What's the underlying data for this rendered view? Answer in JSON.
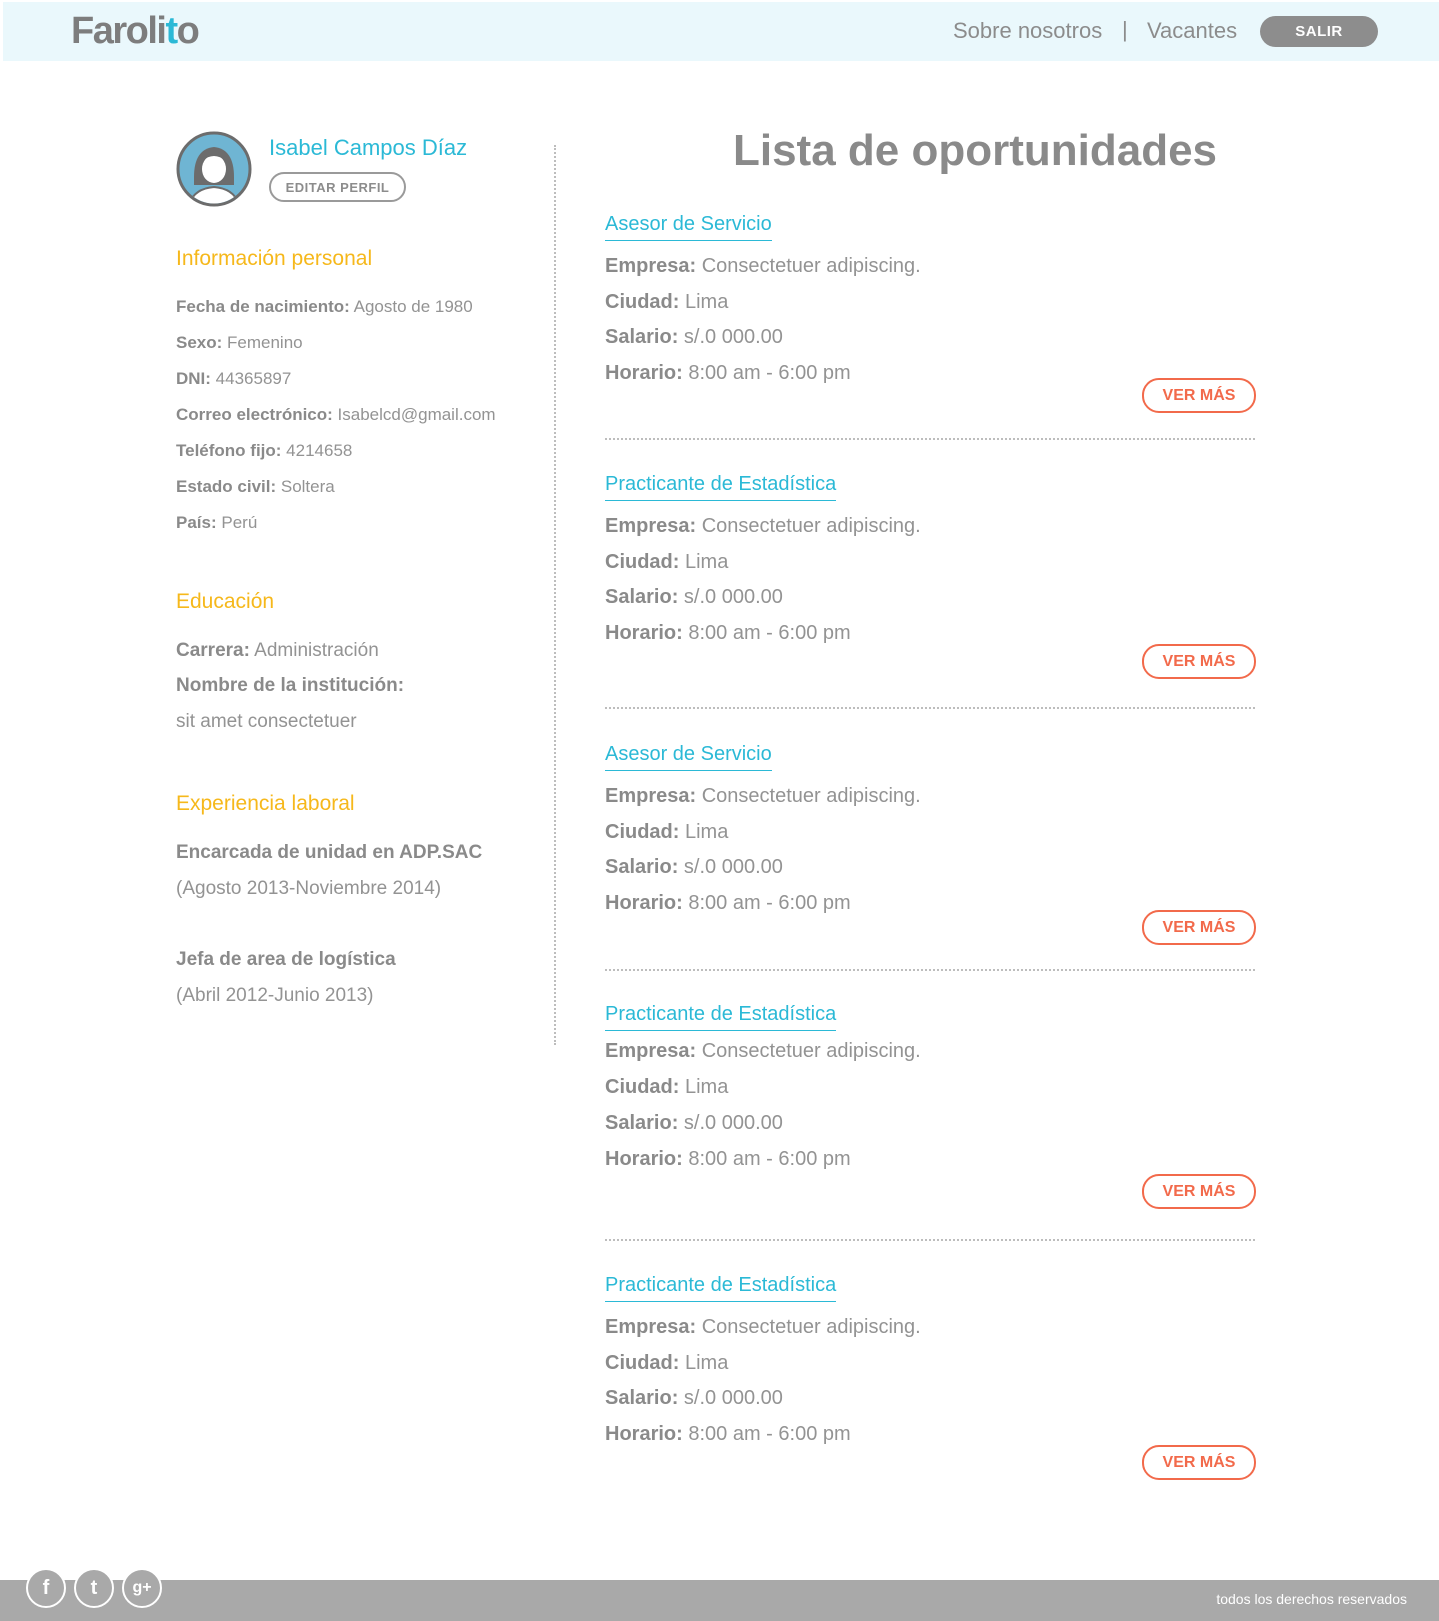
{
  "header": {
    "logo_main": "Faroli",
    "logo_accent": "t",
    "logo_tail": "o",
    "nav_about": "Sobre nosotros",
    "nav_separator": "|",
    "nav_jobs": "Vacantes",
    "logout_label": "SALIR"
  },
  "profile": {
    "name": "Isabel Campos Díaz",
    "edit_label": "EDITAR PERFIL",
    "personal_title": "Información personal",
    "personal": [
      {
        "label": "Fecha de nacimiento:",
        "value": " Agosto de 1980"
      },
      {
        "label": "Sexo:",
        "value": " Femenino"
      },
      {
        "label": "DNI:",
        "value": " 44365897"
      },
      {
        "label": "Correo electrónico:",
        "value": " Isabelcd@gmail.com"
      },
      {
        "label": "Teléfono fijo:",
        "value": " 4214658"
      },
      {
        "label": "Estado civil:",
        "value": " Soltera"
      },
      {
        "label": "País:",
        "value": " Perú"
      }
    ],
    "education_title": "Educación",
    "career_label": "Carrera:",
    "career_value": " Administración",
    "institution_label": "Nombre de la institución:",
    "institution_value": "sit amet consectetuer",
    "experience_title": "Experiencia laboral",
    "experience": [
      {
        "role": "Encarcada de unidad en ADP.SAC",
        "period": "(Agosto 2013-Noviembre 2014)"
      },
      {
        "role": "Jefa de area de logística",
        "period": "(Abril 2012-Junio 2013)"
      }
    ]
  },
  "opportunities": {
    "title": "Lista de oportunidades",
    "labels": {
      "company": "Empresa:",
      "city": "Ciudad:",
      "salary": "Salario:",
      "schedule": "Horario:"
    },
    "more_label": "VER MÁS",
    "jobs": [
      {
        "title": "Asesor de Servicio",
        "company": "  Consectetuer adipiscing.",
        "city": " Lima",
        "salary": " s/.0 000.00",
        "schedule": " 8:00 am - 6:00 pm"
      },
      {
        "title": "Practicante de Estadística",
        "company": "  Consectetuer adipiscing.",
        "city": " Lima",
        "salary": " s/.0 000.00",
        "schedule": " 8:00 am - 6:00 pm"
      },
      {
        "title": "Asesor de Servicio",
        "company": "  Consectetuer adipiscing.",
        "city": " Lima",
        "salary": " s/.0 000.00",
        "schedule": " 8:00 am - 6:00 pm"
      },
      {
        "title": "Practicante de Estadística",
        "company": " Consectetuer adipiscing.",
        "city": " Lima",
        "salary": " s/.0 000.00",
        "schedule": " 8:00 am - 6:00 pm"
      },
      {
        "title": "Practicante de Estadística",
        "company": "  Consectetuer adipiscing.",
        "city": " Lima",
        "salary": " s/.0 000.00",
        "schedule": " 8:00 am - 6:00 pm"
      }
    ]
  },
  "footer": {
    "social": [
      {
        "icon": "facebook-icon",
        "glyph": "f"
      },
      {
        "icon": "twitter-icon",
        "glyph": "t"
      },
      {
        "icon": "google-plus-icon",
        "glyph": "g+"
      }
    ],
    "copyright": "todos los derechos reservados"
  },
  "colors": {
    "accent": "#2bb9d6",
    "section_title": "#f6b81b",
    "action": "#f26a4b",
    "header_bg": "#eaf8fc",
    "footer_bg": "#a9a9a9"
  }
}
